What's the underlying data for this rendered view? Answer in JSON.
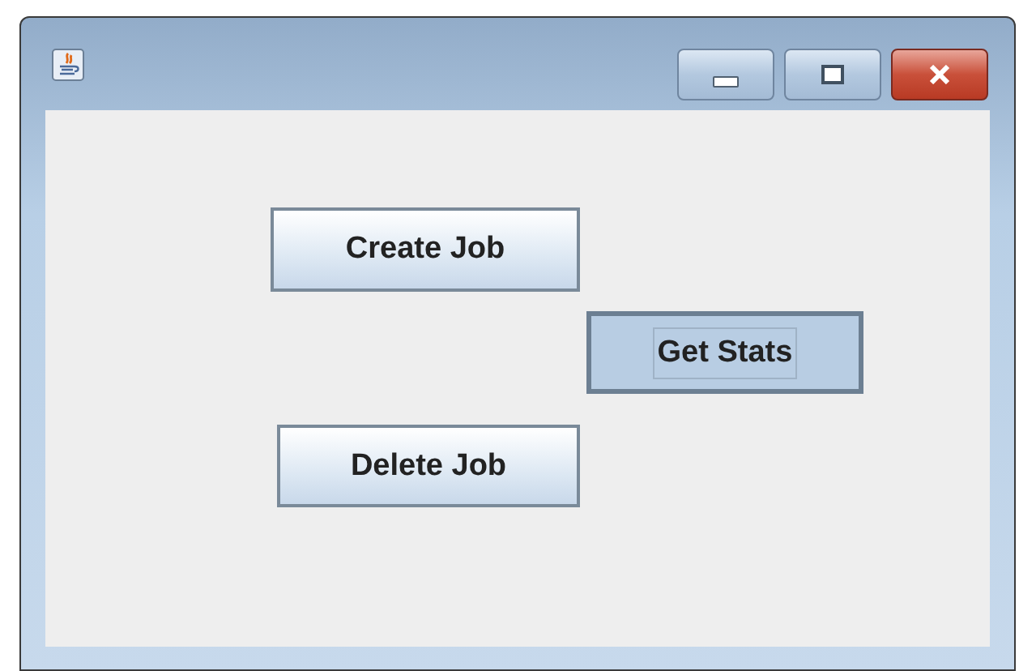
{
  "buttons": [
    {
      "label": "Create Job",
      "pressed": false
    },
    {
      "label": "Get Stats",
      "pressed": true
    },
    {
      "label": "Delete Job",
      "pressed": false
    }
  ]
}
